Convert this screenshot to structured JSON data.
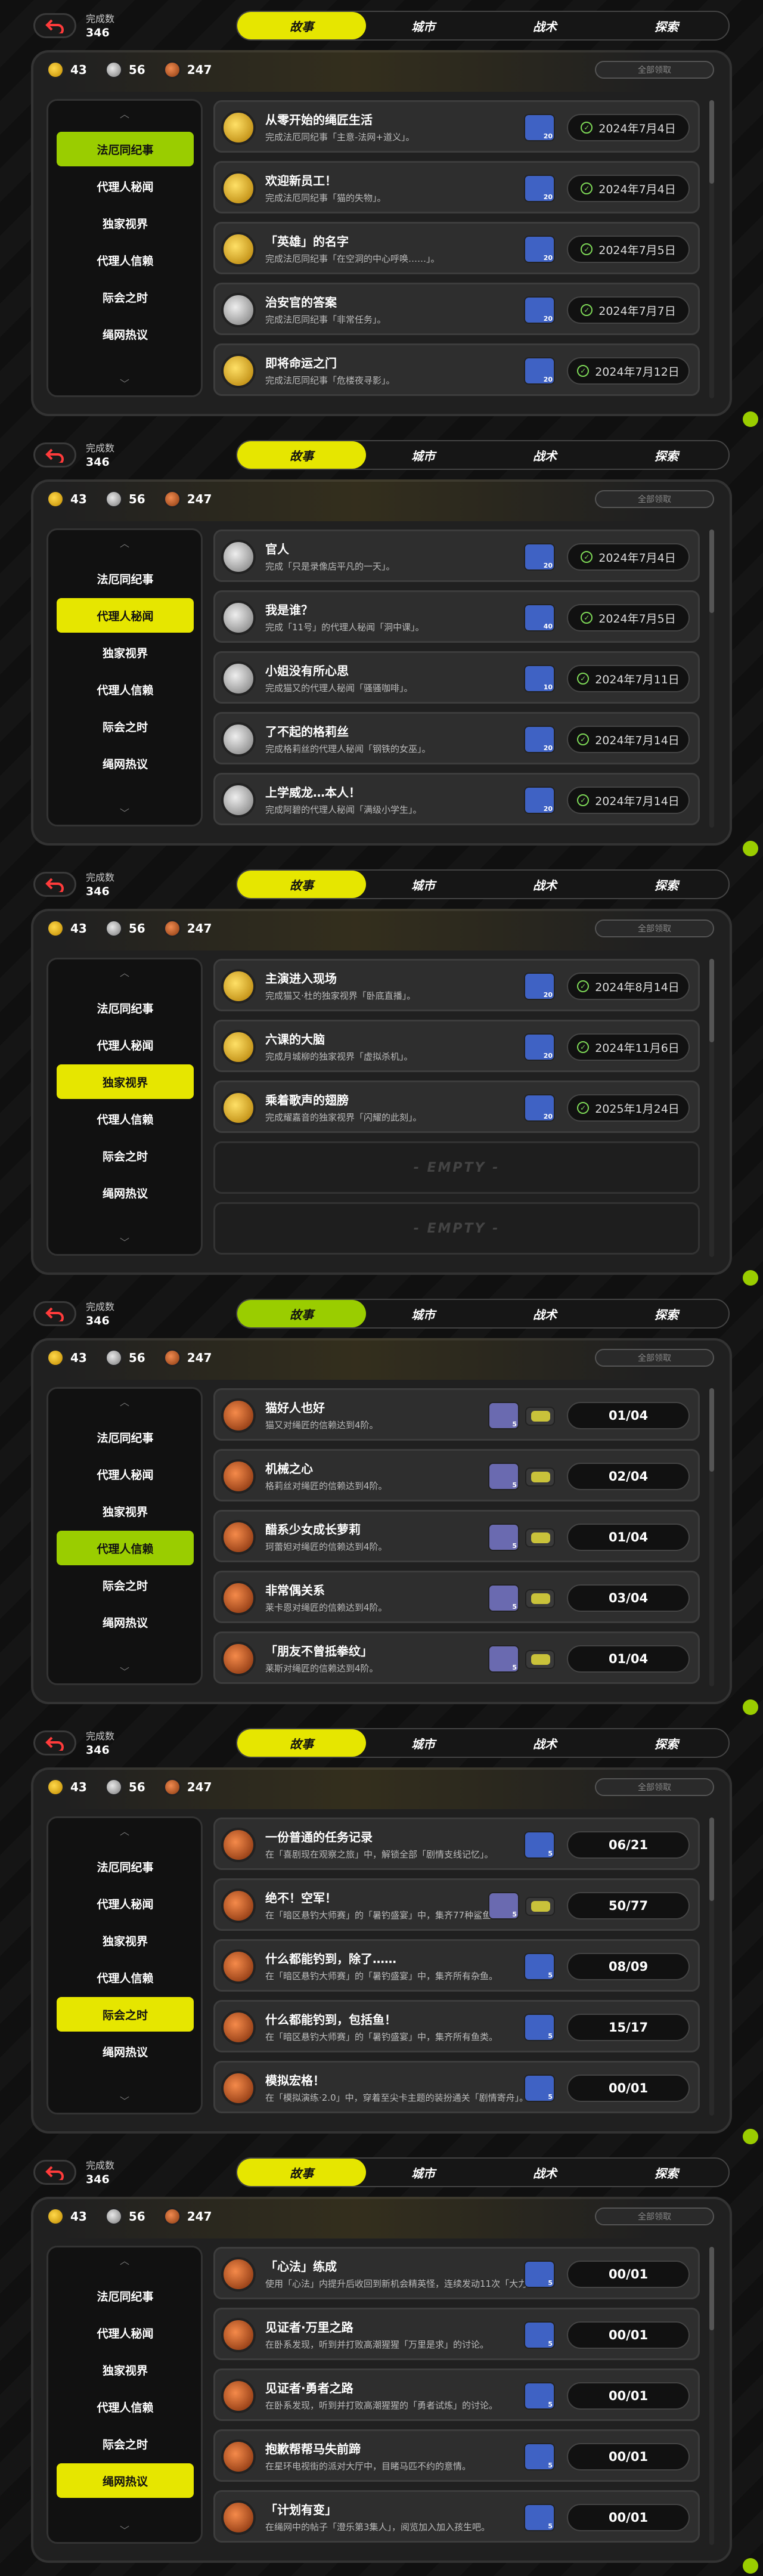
{
  "common": {
    "completion_label": "完成数",
    "completion_value": "346",
    "tabs": [
      "故事",
      "城市",
      "战术",
      "探索"
    ],
    "currencies": [
      {
        "type": "gold",
        "value": "43"
      },
      {
        "type": "silver",
        "value": "56"
      },
      {
        "type": "bronze",
        "value": "247"
      }
    ],
    "claim_all": "全部领取",
    "sidebar": [
      "法厄同纪事",
      "代理人秘闻",
      "独家视界",
      "代理人信赖",
      "际会之时",
      "绳网热议"
    ],
    "empty_label": "- EMPTY -",
    "colors": {
      "accent_yellow": "#e6e600",
      "accent_lime": "#9acd00",
      "check_green": "#7ed957"
    }
  },
  "panels": [
    {
      "active_tab": 0,
      "tab_color": "yellow",
      "active_sidebar": 0,
      "sidebar_color": "lime",
      "rows": [
        {
          "medal": "gold",
          "title": "从零开始的绳匠生活",
          "desc": "完成法厄同纪事「主意-法网+道义」。",
          "reward_count": "20",
          "date": "2024年7月4日"
        },
        {
          "medal": "gold",
          "title": "欢迎新员工！",
          "desc": "完成法厄同纪事「猫的失物」。",
          "reward_count": "20",
          "date": "2024年7月4日"
        },
        {
          "medal": "gold",
          "title": "「英雄」的名字",
          "desc": "完成法厄同纪事「在空洞的中心呼唤……」。",
          "reward_count": "20",
          "date": "2024年7月5日"
        },
        {
          "medal": "silver",
          "title": "治安官的答案",
          "desc": "完成法厄同纪事「非常任务」。",
          "reward_count": "20",
          "date": "2024年7月7日"
        },
        {
          "medal": "gold",
          "title": "即将命运之门",
          "desc": "完成法厄同纪事「危楼夜寻影」。",
          "reward_count": "20",
          "date": "2024年7月12日"
        }
      ]
    },
    {
      "active_tab": 0,
      "tab_color": "yellow",
      "active_sidebar": 1,
      "sidebar_color": "yellow",
      "rows": [
        {
          "medal": "silver",
          "title": "官人",
          "desc": "完成「只是录像店平凡的一天」。",
          "reward_count": "20",
          "date": "2024年7月4日"
        },
        {
          "medal": "silver",
          "title": "我是谁？",
          "desc": "完成「11号」的代理人秘闻「洞中课」。",
          "reward_count": "40",
          "date": "2024年7月5日"
        },
        {
          "medal": "silver",
          "title": "小姐没有所心思",
          "desc": "完成猫又的代理人秘闻「骚骚咖啡」。",
          "reward_count": "10",
          "date": "2024年7月11日"
        },
        {
          "medal": "silver",
          "title": "了不起的格莉丝",
          "desc": "完成格莉丝的代理人秘闻「钢铁的女巫」。",
          "reward_count": "20",
          "date": "2024年7月14日"
        },
        {
          "medal": "silver",
          "title": "上学威龙…本人！",
          "desc": "完成阿碧的代理人秘闻「满级小学生」。",
          "reward_count": "20",
          "date": "2024年7月14日"
        }
      ]
    },
    {
      "active_tab": 0,
      "tab_color": "yellow",
      "active_sidebar": 2,
      "sidebar_color": "yellow",
      "rows": [
        {
          "medal": "gold",
          "title": "主演进入现场",
          "desc": "完成猫又·杜的独家视界「卧底直播」。",
          "reward_count": "20",
          "date": "2024年8月14日"
        },
        {
          "medal": "gold",
          "title": "六课的大脑",
          "desc": "完成月城柳的独家视界「虚拟杀机」。",
          "reward_count": "20",
          "date": "2024年11月6日"
        },
        {
          "medal": "gold",
          "title": "乘着歌声的翅膀",
          "desc": "完成耀嘉音的独家视界「闪耀的此刻」。",
          "reward_count": "20",
          "date": "2025年1月24日"
        },
        {
          "empty": true
        },
        {
          "empty": true
        }
      ]
    },
    {
      "active_tab": 0,
      "tab_color": "lime",
      "active_sidebar": 3,
      "sidebar_color": "lime",
      "rows": [
        {
          "medal": "bronze",
          "title": "猫好人也好",
          "desc": "猫又对绳匠的信赖达到4阶。",
          "reward_count": "5",
          "progress": "01/04",
          "multi": true
        },
        {
          "medal": "bronze",
          "title": "机械之心",
          "desc": "格莉丝对绳匠的信赖达到4阶。",
          "reward_count": "5",
          "progress": "02/04",
          "multi": true
        },
        {
          "medal": "bronze",
          "title": "醋系少女成长萝莉",
          "desc": "珂蕾妲对绳匠的信赖达到4阶。",
          "reward_count": "5",
          "progress": "01/04",
          "multi": true
        },
        {
          "medal": "bronze",
          "title": "非常偶关系",
          "desc": "莱卡恩对绳匠的信赖达到4阶。",
          "reward_count": "5",
          "progress": "03/04",
          "multi": true
        },
        {
          "medal": "bronze",
          "title": "「朋友不曾抵拳纹」",
          "desc": "莱斯对绳匠的信赖达到4阶。",
          "reward_count": "5",
          "progress": "01/04",
          "multi": true
        }
      ]
    },
    {
      "active_tab": 0,
      "tab_color": "yellow",
      "active_sidebar": 4,
      "sidebar_color": "yellow",
      "rows": [
        {
          "medal": "bronze",
          "title": "一份普通的任务记录",
          "desc": "在「喜剧现在观察之旅」中，解锁全部「剧情支线记忆」。",
          "reward_count": "5",
          "progress": "06/21"
        },
        {
          "medal": "bronze",
          "title": "绝不！空军！",
          "desc": "在「暗区悬钓大师赛」的「暑钓盛宴」中，集齐77种鲨鱼。",
          "reward_count": "5",
          "progress": "50/77",
          "multi": true
        },
        {
          "medal": "bronze",
          "title": "什么都能钓到，除了……",
          "desc": "在「暗区悬钓大师赛」的「暑钓盛宴」中，集齐所有杂鱼。",
          "reward_count": "5",
          "progress": "08/09"
        },
        {
          "medal": "bronze",
          "title": "什么都能钓到，包括鱼！",
          "desc": "在「暗区悬钓大师赛」的「暑钓盛宴」中，集齐所有鱼类。",
          "reward_count": "5",
          "progress": "15/17"
        },
        {
          "medal": "bronze",
          "title": "模拟宏格！",
          "desc": "在「模拟演练·2.0」中，穿着至尖卡主题的装扮通关「剧情寄舟」。",
          "reward_count": "5",
          "progress": "00/01"
        }
      ]
    },
    {
      "active_tab": 0,
      "tab_color": "yellow",
      "active_sidebar": 5,
      "sidebar_color": "yellow",
      "rows": [
        {
          "medal": "bronze",
          "title": "「心法」练成",
          "desc": "使用「心法」内提升后收回到新机会精英怪，连续发动11次「大力骰压」。",
          "reward_count": "5",
          "progress": "00/01"
        },
        {
          "medal": "bronze",
          "title": "见证者·万里之路",
          "desc": "在卧系发现，听到并打败高潮猩猩「万里是求」的讨论。",
          "reward_count": "5",
          "progress": "00/01"
        },
        {
          "medal": "bronze",
          "title": "见证者·勇者之路",
          "desc": "在卧系发现，听到并打败高潮猩猩的「勇者试炼」的讨论。",
          "reward_count": "5",
          "progress": "00/01"
        },
        {
          "medal": "bronze",
          "title": "抱歉帮帮马失前蹄",
          "desc": "在星环电视街的派对大厅中，目睹马匹不约的意情。",
          "reward_count": "5",
          "progress": "00/01"
        },
        {
          "medal": "bronze",
          "title": "「计划有变」",
          "desc": "在绳网中的帖子「澄乐第3集人」，阅览加入加入孩生吧。",
          "reward_count": "5",
          "progress": "00/01"
        }
      ]
    }
  ]
}
